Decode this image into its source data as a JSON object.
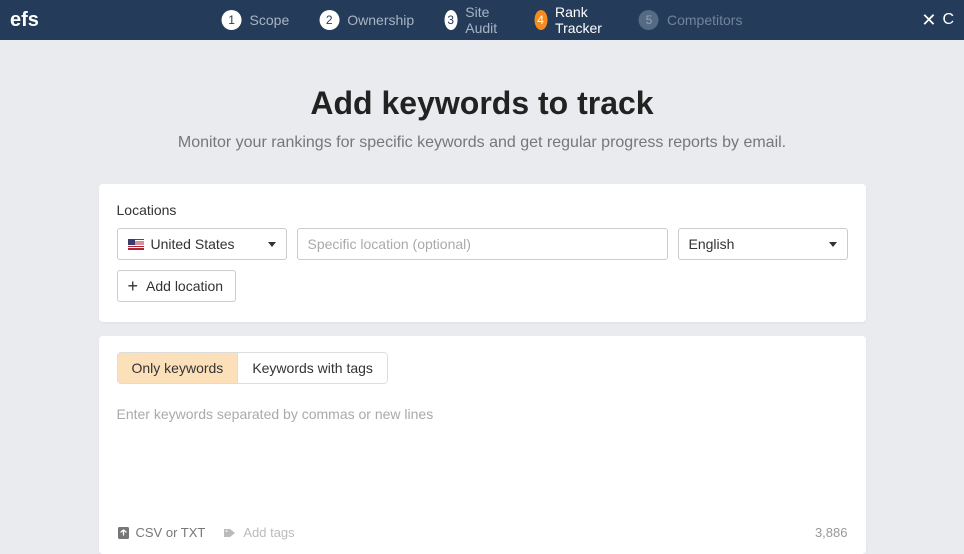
{
  "header": {
    "logo_fragment": "efs",
    "steps": [
      {
        "num": "1",
        "label": "Scope",
        "state": "normal"
      },
      {
        "num": "2",
        "label": "Ownership",
        "state": "normal"
      },
      {
        "num": "3",
        "label": "Site Audit",
        "state": "normal"
      },
      {
        "num": "4",
        "label": "Rank Tracker",
        "state": "active"
      },
      {
        "num": "5",
        "label": "Competitors",
        "state": "disabled"
      }
    ],
    "close_label": "C"
  },
  "title": "Add keywords to track",
  "subtitle": "Monitor your rankings for specific keywords and get regular progress reports by email.",
  "locations": {
    "label": "Locations",
    "country": "United States",
    "specific_placeholder": "Specific location (optional)",
    "language": "English",
    "add_label": "Add location"
  },
  "keywords": {
    "tabs": [
      "Only keywords",
      "Keywords with tags"
    ],
    "active_tab": 0,
    "placeholder": "Enter keywords separated by commas or new lines",
    "csv_label": "CSV or TXT",
    "addtags_label": "Add tags",
    "count": "3,886"
  }
}
